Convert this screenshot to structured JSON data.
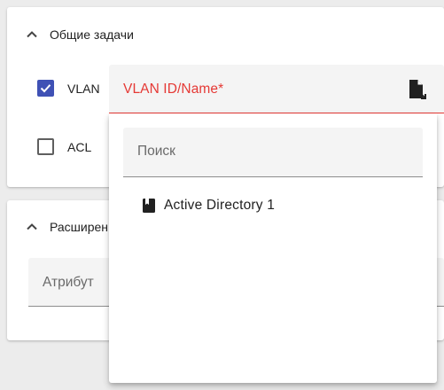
{
  "sections": {
    "general": {
      "title": "Общие задачи",
      "checkboxes": [
        {
          "label": "VLAN",
          "checked": true
        },
        {
          "label": "ACL",
          "checked": false
        }
      ],
      "vlan_field": {
        "label": "VLAN ID/Name*",
        "icon": "file-select-icon"
      }
    },
    "advanced": {
      "title": "Расширен",
      "attribute_field": {
        "label": "Атрибут"
      }
    }
  },
  "dropdown": {
    "search_placeholder": "Поиск",
    "options": [
      {
        "label": "Active Directory 1",
        "icon": "book-icon"
      }
    ]
  },
  "colors": {
    "accent": "#3f51b5",
    "error": "#e53935",
    "background": "#ececec"
  }
}
